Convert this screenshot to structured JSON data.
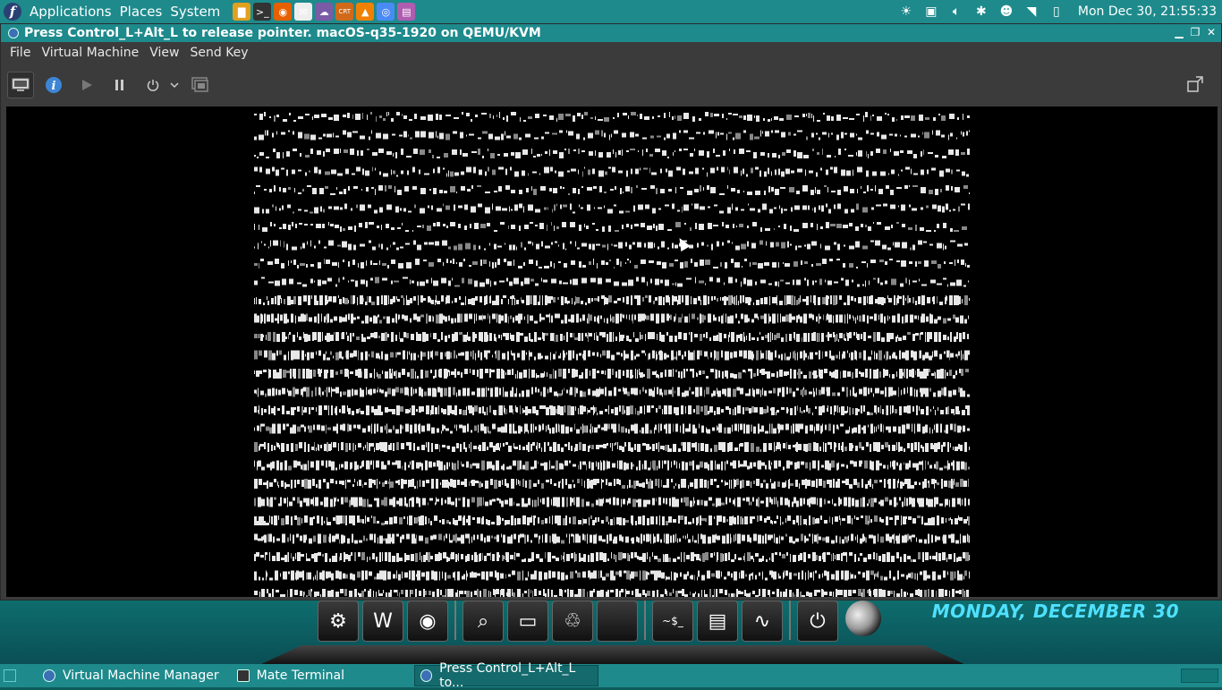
{
  "top_panel": {
    "menus": [
      "Applications",
      "Places",
      "System"
    ],
    "launchers": [
      {
        "name": "folder-launcher-icon",
        "glyph": "▇",
        "color": "#e0a020"
      },
      {
        "name": "terminal-launcher-icon",
        "glyph": ">_",
        "color": "#333333"
      },
      {
        "name": "firefox-launcher-icon",
        "glyph": "◉",
        "color": "#e66000"
      },
      {
        "name": "mail-launcher-icon",
        "glyph": "✉",
        "color": "#eeeeee"
      },
      {
        "name": "chat-launcher-icon",
        "glyph": "☁",
        "color": "#7b5aa6"
      },
      {
        "name": "crt-launcher-icon",
        "glyph": "CRT",
        "color": "#d06a1a"
      },
      {
        "name": "vlc-launcher-icon",
        "glyph": "▲",
        "color": "#f08000"
      },
      {
        "name": "chrome-launcher-icon",
        "glyph": "◎",
        "color": "#4a8af4"
      },
      {
        "name": "notes-launcher-icon",
        "glyph": "▤",
        "color": "#b05cb0"
      }
    ],
    "clock": "Mon Dec 30, 21:55:33"
  },
  "vm_window": {
    "title": "Press Control_L+Alt_L to release pointer. macOS-q35-1920 on QEMU/KVM",
    "menubar": [
      "File",
      "Virtual Machine",
      "View",
      "Send Key"
    ]
  },
  "desktop": {
    "date_text": "MONDAY, DECEMBER 30",
    "dock_items": [
      {
        "name": "ubuntu-dock-icon",
        "glyph": "⚙"
      },
      {
        "name": "writer-dock-icon",
        "glyph": "W"
      },
      {
        "name": "firefox-dock-icon",
        "glyph": "◉"
      },
      {
        "name": "search-dock-icon",
        "glyph": "⌕"
      },
      {
        "name": "monitor-dock-icon",
        "glyph": "▭"
      },
      {
        "name": "trash-dock-icon",
        "glyph": "♲"
      },
      {
        "name": "blank-dock-icon",
        "glyph": ""
      },
      {
        "name": "terminal-dock-icon",
        "glyph": "~$_"
      },
      {
        "name": "files-dock-icon",
        "glyph": "▤"
      },
      {
        "name": "system-monitor-dock-icon",
        "glyph": "∿"
      },
      {
        "name": "power-dock-icon",
        "glyph": "⏻"
      }
    ]
  },
  "taskbar": {
    "tasks": [
      "Virtual Machine Manager",
      "Mate Terminal",
      "Press Control_L+Alt_L to..."
    ]
  },
  "colors": {
    "panel": "#1e8a8c",
    "window_bg": "#3b3b3b",
    "date_accent": "#4fe0ff"
  }
}
